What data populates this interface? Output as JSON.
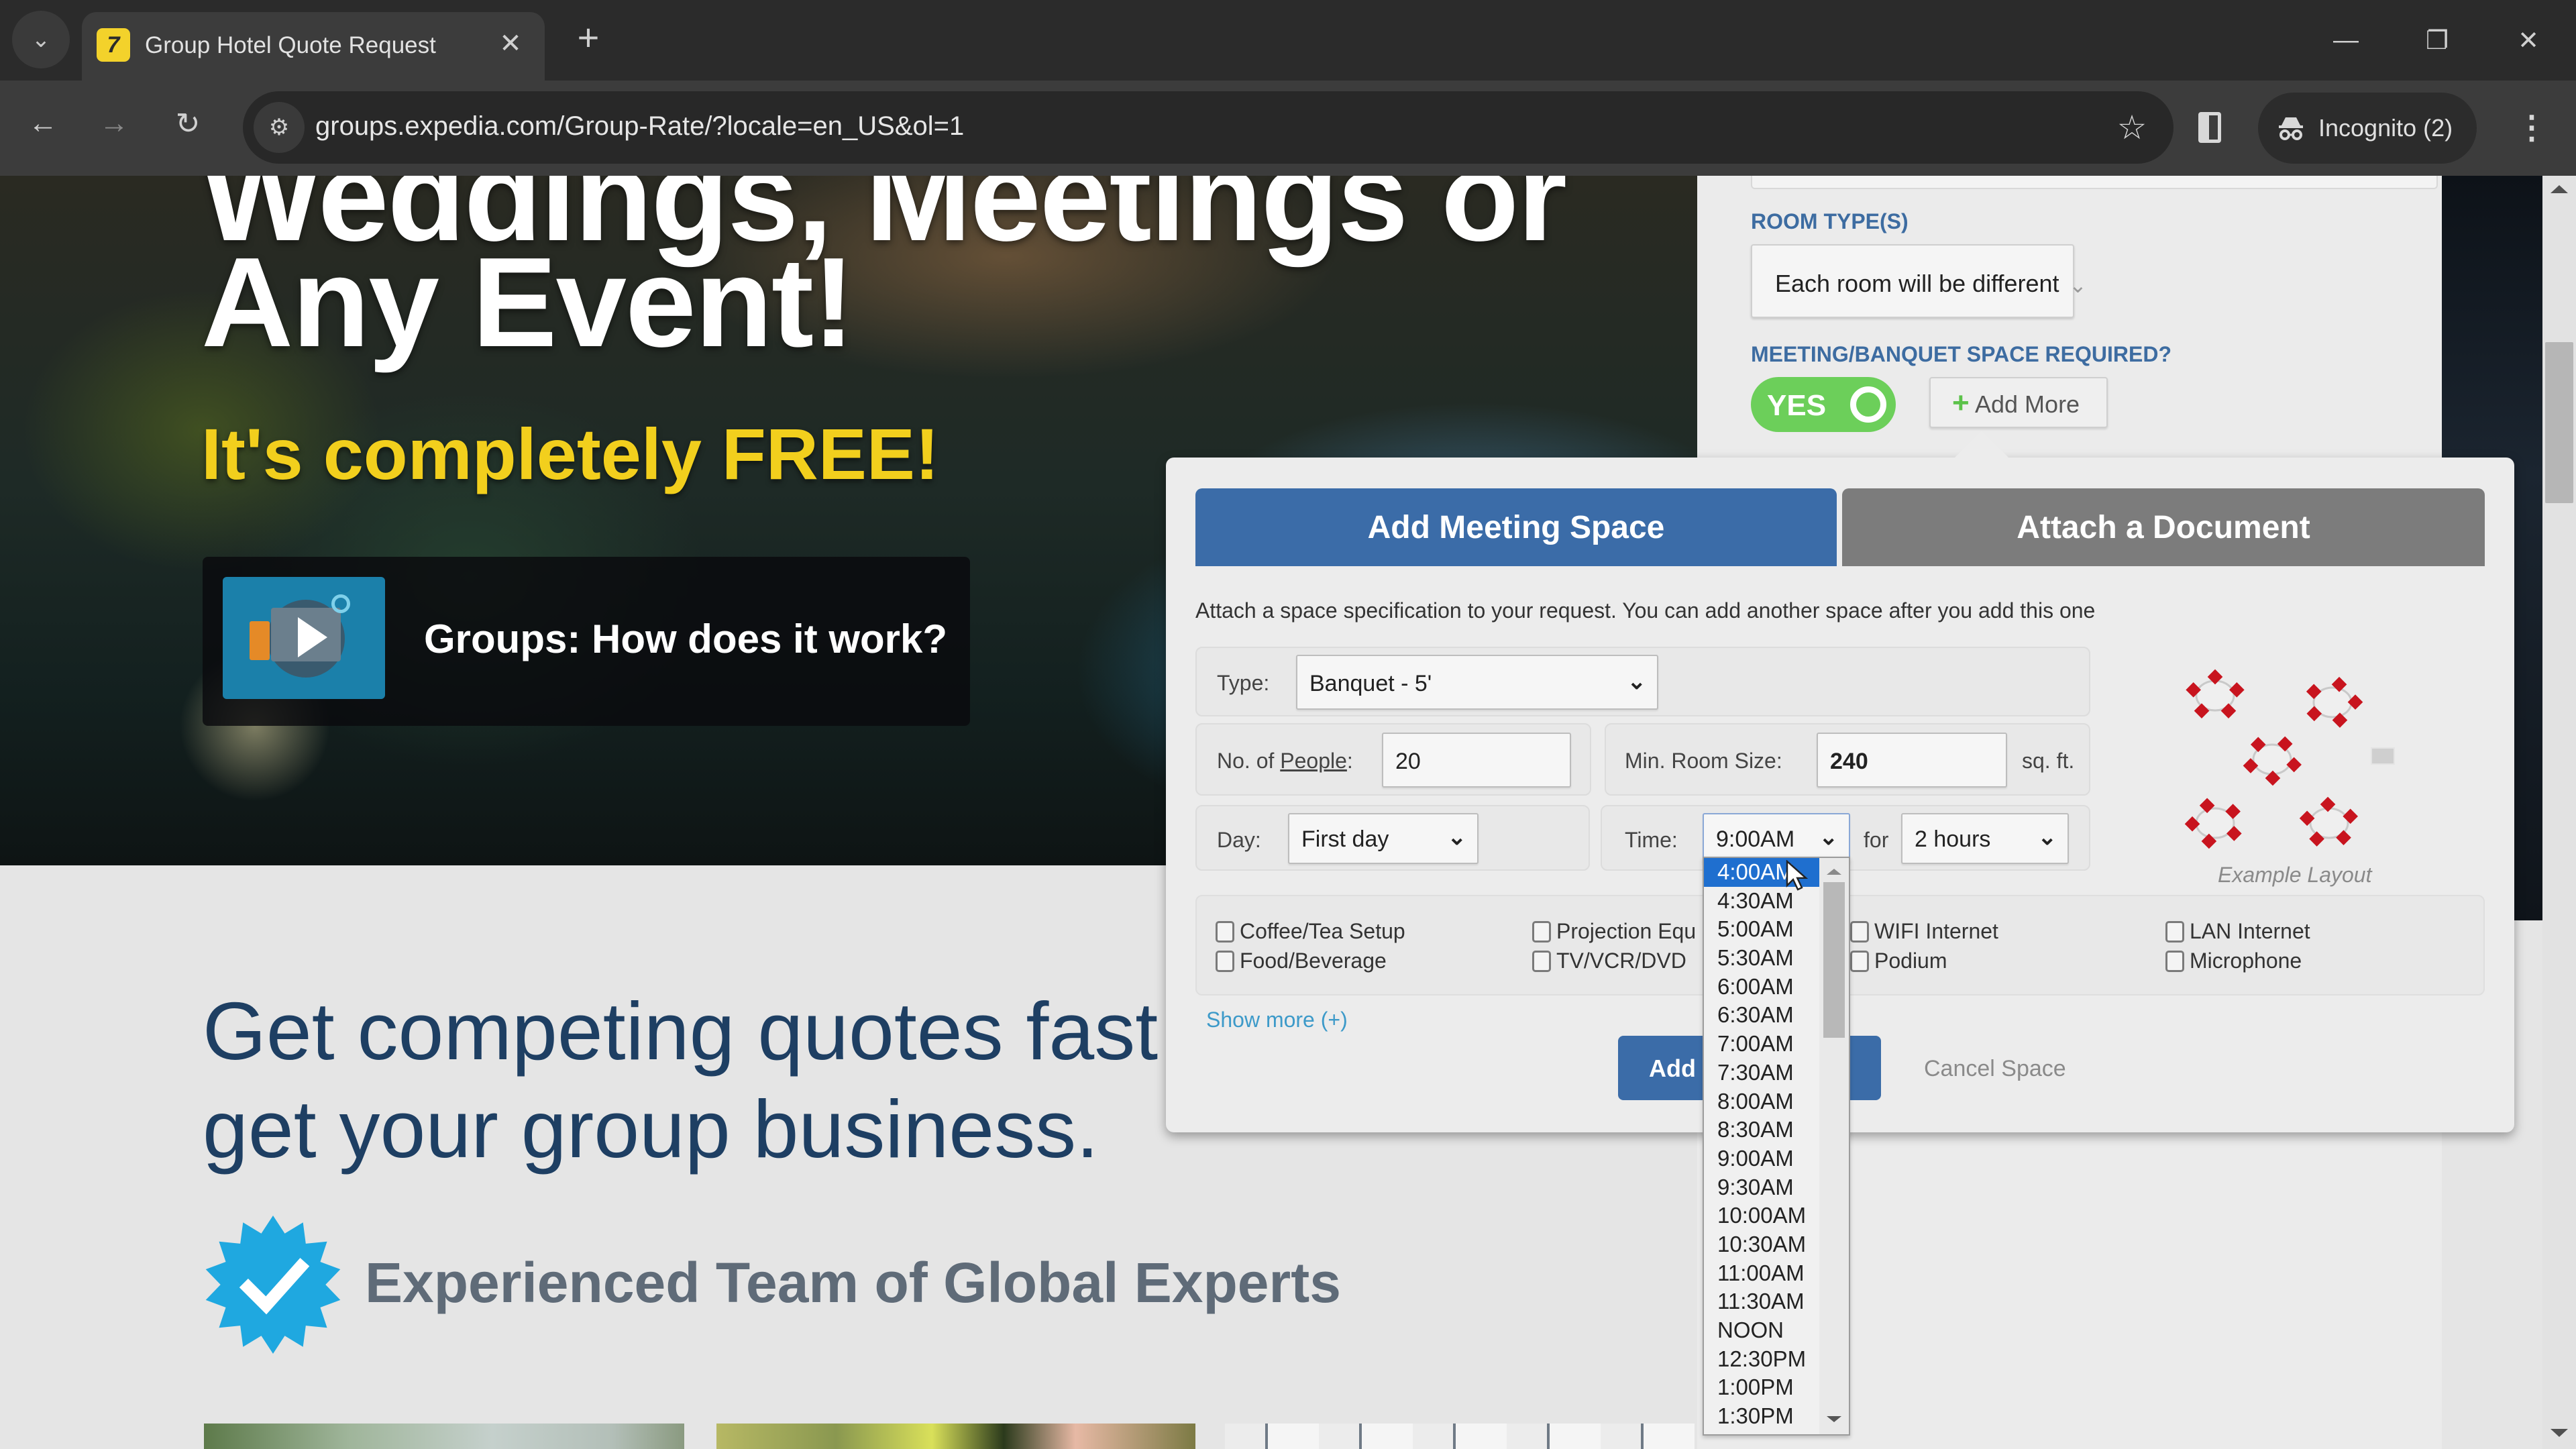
{
  "browser": {
    "tab_title": "Group Hotel Quote Request",
    "favicon_letter": "7",
    "url": "groups.expedia.com/Group-Rate/?locale=en_US&ol=1",
    "profile_label": "Incognito (2)",
    "icons": {
      "tab_search": "chevron-down-icon",
      "tab_close": "close-icon",
      "new_tab": "plus-icon",
      "back": "back-arrow-icon",
      "forward": "forward-arrow-icon",
      "reload": "reload-icon",
      "site_info": "tune-icon",
      "bookmark": "star-icon",
      "side_panel": "side-panel-icon",
      "incognito": "incognito-icon",
      "menu": "kebab-menu-icon",
      "minimize": "minimize-icon",
      "restore": "restore-icon",
      "close": "close-icon"
    },
    "glyphs": {
      "tab_search": "⌄",
      "tab_close": "✕",
      "new_tab": "+",
      "back": "←",
      "forward": "→",
      "reload": "↻",
      "site_info": "⚙",
      "bookmark": "☆",
      "incognito": "🕶",
      "menu": "⋮",
      "minimize": "—",
      "restore": "❐",
      "close": "✕"
    }
  },
  "hero": {
    "line0": "Weddings, Meetings or",
    "line1": "Any Event!",
    "free": "It's completely FREE!",
    "video_title": "Groups: How does it work?"
  },
  "main": {
    "tagline_1": "Get competing quotes fast",
    "tagline_2": "get your group business.",
    "experts": "Experienced Team of Global Experts"
  },
  "form": {
    "room_types_label": "ROOM TYPE(S)",
    "room_types_value": "Each room will be different",
    "meeting_space_label": "MEETING/BANQUET SPACE REQUIRED?",
    "toggle_label": "YES",
    "toggle_on": true,
    "add_more_plus": "+",
    "add_more_label": "Add More"
  },
  "modal": {
    "tabs": [
      {
        "label": "Add Meeting Space",
        "active": true
      },
      {
        "label": "Attach a Document",
        "active": false
      }
    ],
    "description": "Attach a space specification to your request. You can add another space after you add this one",
    "type_label": "Type:",
    "type_value": "Banquet - 5'",
    "people_label_prefix": "No. of ",
    "people_label_link": "People",
    "people_label_suffix": ":",
    "people_value": "20",
    "room_size_label": "Min. Room Size:",
    "room_size_value": "240",
    "room_size_unit": "sq. ft.",
    "day_label": "Day:",
    "day_value": "First day",
    "time_label": "Time:",
    "time_value": "9:00AM",
    "for_label": "for",
    "duration_value": "2 hours",
    "caret": "⌄",
    "layout_caption": "Example Layout",
    "amenities": [
      {
        "label": "Coffee/Tea Setup",
        "checked": false
      },
      {
        "label": "Food/Beverage",
        "checked": false
      },
      {
        "label": "Projection Equ",
        "checked": false
      },
      {
        "label": "TV/VCR/DVD",
        "checked": false
      },
      {
        "label": "WIFI Internet",
        "checked": false
      },
      {
        "label": "Podium",
        "checked": false
      },
      {
        "label": "LAN Internet",
        "checked": false
      },
      {
        "label": "Microphone",
        "checked": false
      }
    ],
    "show_more": "Show more (+)",
    "add_button_label": "Add t",
    "cancel_label": "Cancel Space"
  },
  "time_dropdown": {
    "selected": "4:00AM",
    "options": [
      "4:00AM",
      "4:30AM",
      "5:00AM",
      "5:30AM",
      "6:00AM",
      "6:30AM",
      "7:00AM",
      "7:30AM",
      "8:00AM",
      "8:30AM",
      "9:00AM",
      "9:30AM",
      "10:00AM",
      "10:30AM",
      "11:00AM",
      "11:30AM",
      "NOON",
      "12:30PM",
      "1:00PM",
      "1:30PM"
    ]
  },
  "colors": {
    "primary_blue": "#3b6ca8",
    "inactive_tab": "#7c7c7c",
    "toggle_green": "#6ccf5a",
    "free_yellow": "#f2cf1d",
    "label_blue": "#3d6ca1",
    "tagline_navy": "#1e3f63",
    "badge_blue": "#1fa8e0",
    "dropdown_highlight": "#1f6fcf",
    "table_red": "#c8141e"
  }
}
